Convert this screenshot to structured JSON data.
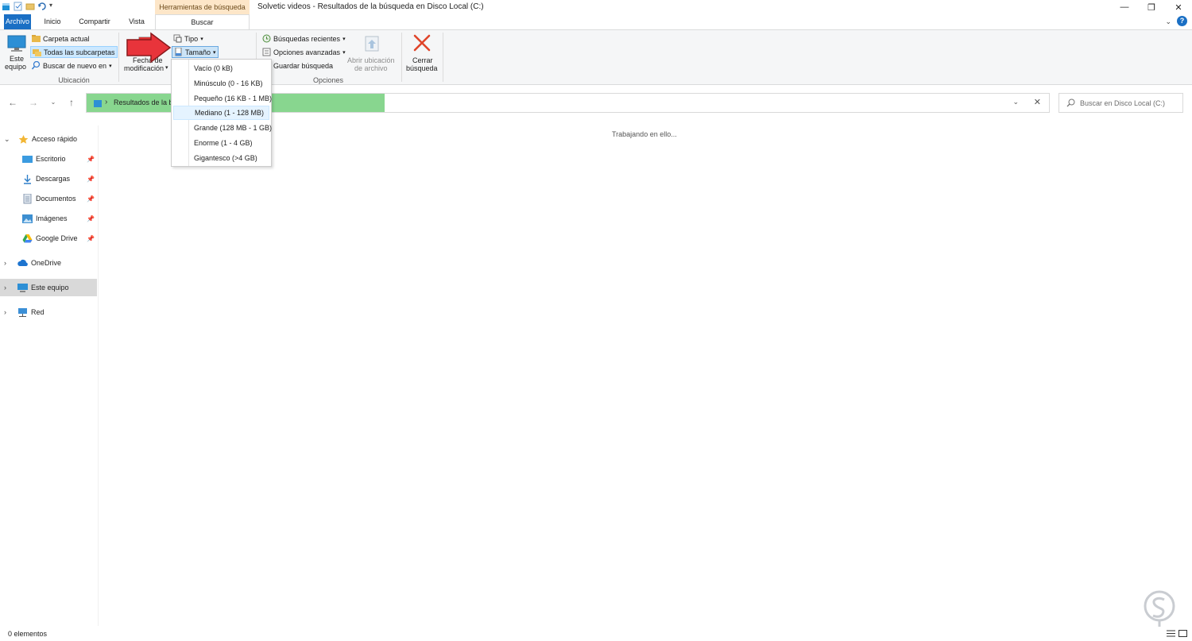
{
  "window": {
    "title": "Solvetic videos - Resultados de la búsqueda en Disco Local (C:)",
    "context_group": "Herramientas de búsqueda"
  },
  "tabs": [
    {
      "label": "Archivo"
    },
    {
      "label": "Inicio"
    },
    {
      "label": "Compartir"
    },
    {
      "label": "Vista"
    },
    {
      "label": "Buscar"
    }
  ],
  "ribbon": {
    "ubicacion": {
      "este_equipo": [
        "Este",
        "equipo"
      ],
      "carpeta_actual": "Carpeta actual",
      "todas_subcarpetas": "Todas las subcarpetas",
      "buscar_de_nuevo": "Buscar de nuevo en",
      "group_label": "Ubicación"
    },
    "refinar": {
      "fecha": [
        "Fecha de",
        "modificación"
      ],
      "tipo": "Tipo",
      "tamano": "Tamaño"
    },
    "opciones": {
      "busquedas_recientes": "Búsquedas recientes",
      "opciones_avanzadas": "Opciones avanzadas",
      "guardar_busqueda": "Guardar búsqueda",
      "abrir_ubicacion": [
        "Abrir ubicación",
        "de archivo"
      ],
      "group_label": "Opciones"
    },
    "cerrar": [
      "Cerrar",
      "búsqueda"
    ]
  },
  "size_menu": [
    "Vacío (0 kB)",
    "Minúsculo (0 - 16 KB)",
    "Pequeño (16 KB - 1 MB)",
    "Mediano (1 - 128 MB)",
    "Grande (128 MB - 1 GB)",
    "Enorme (1 - 4 GB)",
    "Gigantesco (>4 GB)"
  ],
  "address": {
    "path": "Resultados de la b",
    "progress": 0.31
  },
  "search": {
    "placeholder": "Buscar en Disco Local (C:)"
  },
  "nav": {
    "quick_access": "Acceso rápido",
    "pinned": [
      "Escritorio",
      "Descargas",
      "Documentos",
      "Imágenes",
      "Google Drive"
    ],
    "onedrive": "OneDrive",
    "este_equipo": "Este equipo",
    "red": "Red"
  },
  "content": {
    "status": "Trabajando en ello..."
  },
  "statusbar": {
    "count": "0 elementos"
  }
}
